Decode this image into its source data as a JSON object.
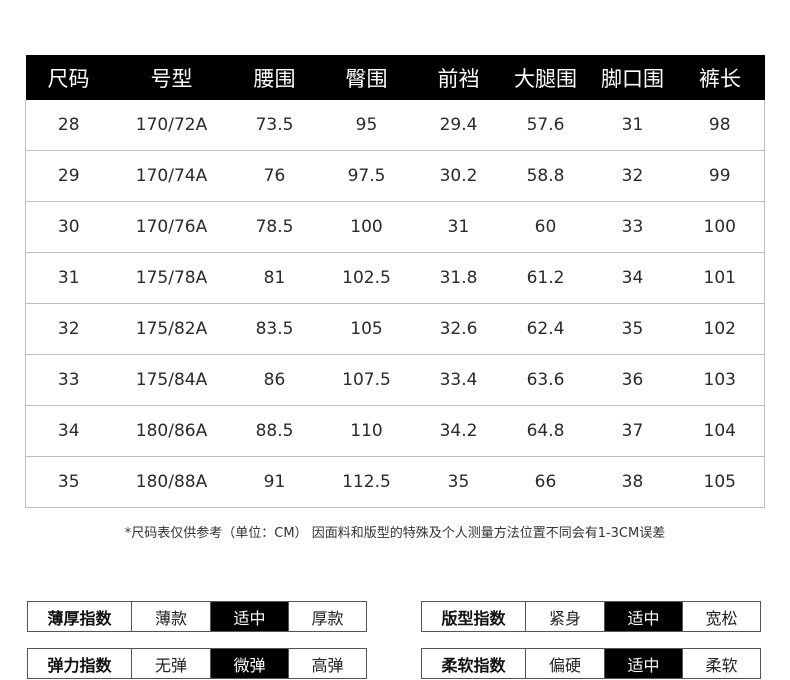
{
  "size_table": {
    "headers": [
      "尺码",
      "号型",
      "腰围",
      "臀围",
      "前裆",
      "大腿围",
      "脚口围",
      "裤长"
    ],
    "rows": [
      [
        "28",
        "170/72A",
        "73.5",
        "95",
        "29.4",
        "57.6",
        "31",
        "98"
      ],
      [
        "29",
        "170/74A",
        "76",
        "97.5",
        "30.2",
        "58.8",
        "32",
        "99"
      ],
      [
        "30",
        "170/76A",
        "78.5",
        "100",
        "31",
        "60",
        "33",
        "100"
      ],
      [
        "31",
        "175/78A",
        "81",
        "102.5",
        "31.8",
        "61.2",
        "34",
        "101"
      ],
      [
        "32",
        "175/82A",
        "83.5",
        "105",
        "32.6",
        "62.4",
        "35",
        "102"
      ],
      [
        "33",
        "175/84A",
        "86",
        "107.5",
        "33.4",
        "63.6",
        "36",
        "103"
      ],
      [
        "34",
        "180/86A",
        "88.5",
        "110",
        "34.2",
        "64.8",
        "37",
        "104"
      ],
      [
        "35",
        "180/88A",
        "91",
        "112.5",
        "35",
        "66",
        "38",
        "105"
      ]
    ]
  },
  "note": "*尺码表仅供参考（单位：CM） 因面料和版型的特殊及个人测量方法位置不同会有1-3CM误差",
  "indices": {
    "thickness": {
      "label": "薄厚指数",
      "options": [
        "薄款",
        "适中",
        "厚款"
      ],
      "selected": 1
    },
    "elasticity": {
      "label": "弹力指数",
      "options": [
        "无弹",
        "微弹",
        "高弹"
      ],
      "selected": 1
    },
    "fit": {
      "label": "版型指数",
      "options": [
        "紧身",
        "适中",
        "宽松"
      ],
      "selected": 1
    },
    "softness": {
      "label": "柔软指数",
      "options": [
        "偏硬",
        "适中",
        "柔软"
      ],
      "selected": 1
    }
  },
  "colors": {
    "header_bg": "#000000",
    "header_text": "#ffffff",
    "selected_bg": "#000000",
    "border": "#bdbdbd"
  }
}
